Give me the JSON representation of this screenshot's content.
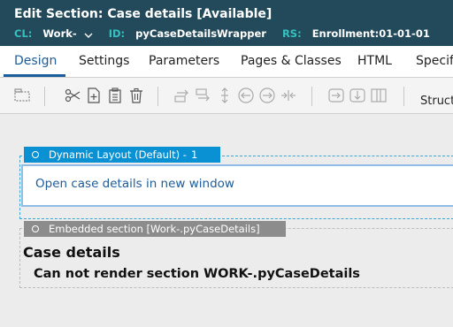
{
  "header": {
    "title": "Edit  Section: Case details [Available]",
    "cl_label": "CL:",
    "cl_value": "Work-",
    "id_label": "ID:",
    "id_value": "pyCaseDetailsWrapper",
    "rs_label": "RS:",
    "rs_value": "Enrollment:01-01-01"
  },
  "tabs": [
    {
      "label": "Design"
    },
    {
      "label": "Settings"
    },
    {
      "label": "Parameters"
    },
    {
      "label": "Pages & Classes"
    },
    {
      "label": "HTML"
    },
    {
      "label": "Specifi"
    }
  ],
  "toolbar": {
    "structure_label": "Structu"
  },
  "dynamic_layout": {
    "label": "Dynamic Layout (Default) -",
    "number": "1",
    "link_text": "Open case details in new window"
  },
  "embedded_section": {
    "label": "Embedded section [Work-.pyCaseDetails]",
    "heading": "Case details",
    "message": "Can not render section WORK-.pyCaseDetails"
  },
  "colors": {
    "header_bg": "#234a5b",
    "meta_key": "#36c1c1",
    "active_tab": "#1b5e9e",
    "dynamic_label_bg": "#0a91d4",
    "embedded_label_bg": "#8c8c8c",
    "link": "#1f5c99"
  }
}
